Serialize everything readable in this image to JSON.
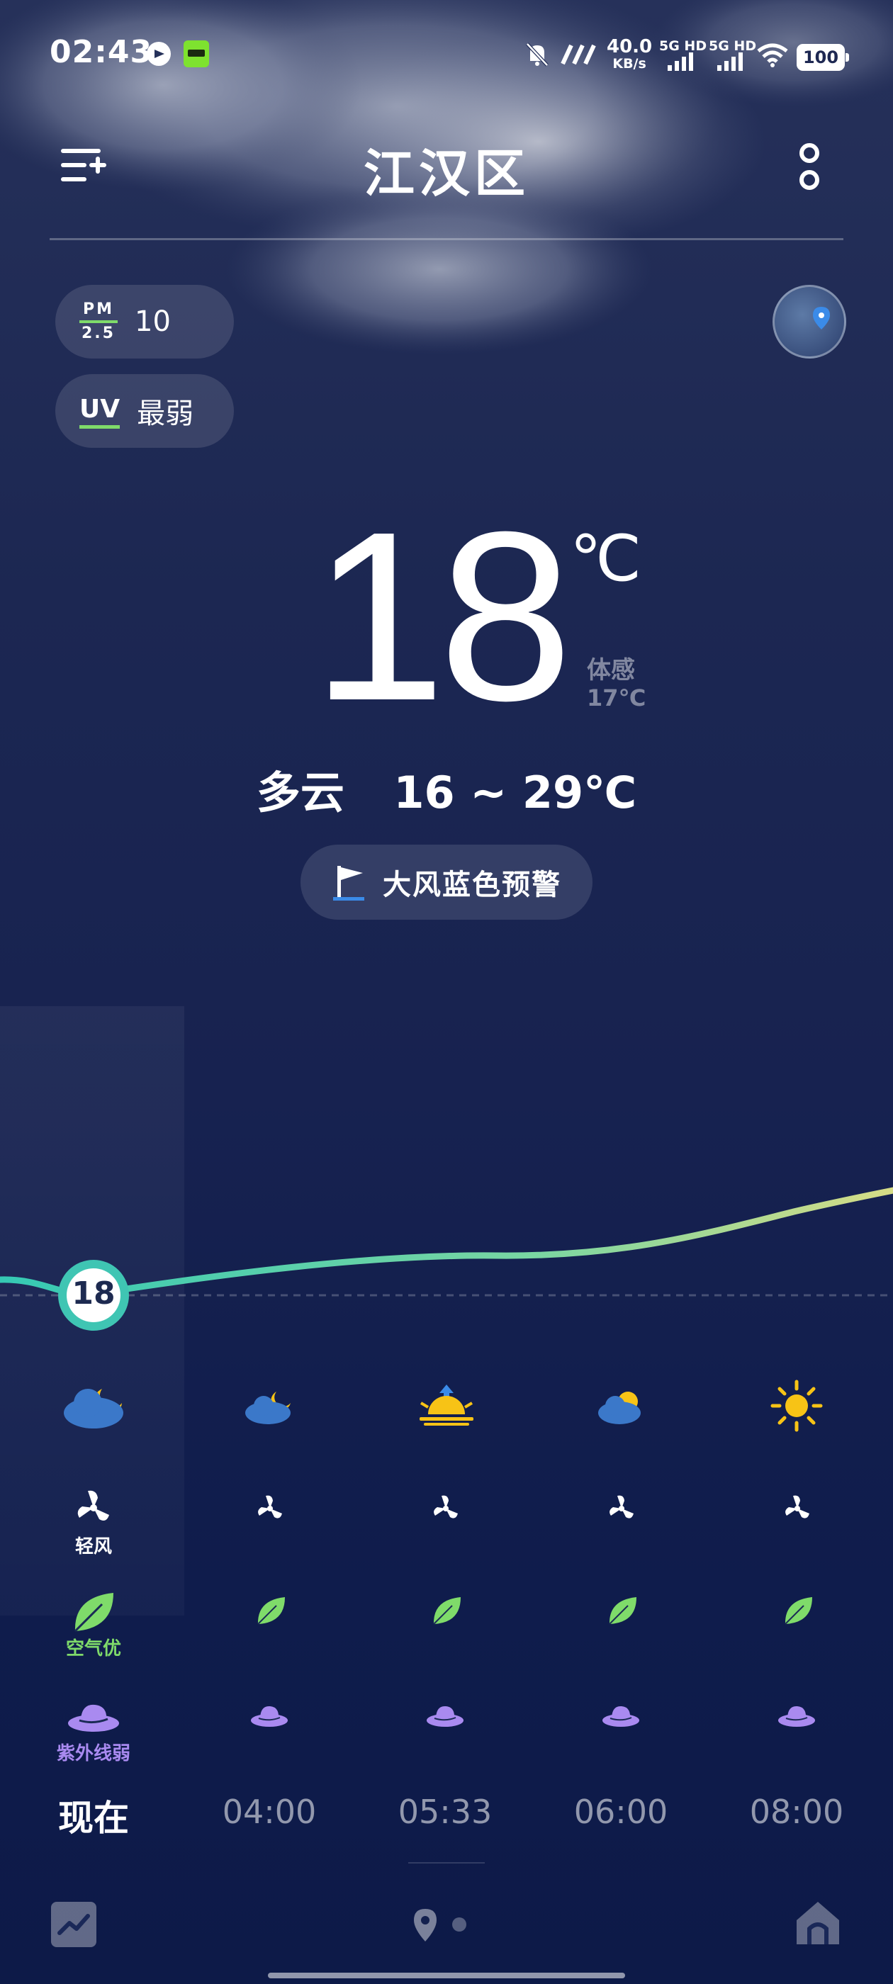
{
  "status_bar": {
    "time": "02:43",
    "net_speed_value": "40.0",
    "net_speed_unit": "KB/s",
    "signal_1": "5G HD",
    "signal_2": "5G HD",
    "battery": "100"
  },
  "header": {
    "city": "江汉区"
  },
  "air": {
    "pm_label_top": "PM",
    "pm_label_bottom": "2.5",
    "pm_value": "10",
    "uv_label": "UV",
    "uv_value": "最弱"
  },
  "current": {
    "temperature": "18",
    "unit": "℃",
    "feels_like_label": "体感",
    "feels_like_value": "17℃",
    "condition": "多云",
    "range": "16 ~ 29℃",
    "alert": "大风蓝色预警"
  },
  "hourly": {
    "now_temp": "18",
    "now_wind": "轻风",
    "now_air": "空气优",
    "now_uv": "紫外线弱",
    "items": [
      {
        "time": "现在",
        "icon": "cloudy-night-icon"
      },
      {
        "time": "04:00",
        "icon": "cloudy-night-icon"
      },
      {
        "time": "05:33",
        "icon": "sunrise-icon"
      },
      {
        "time": "06:00",
        "icon": "partly-cloudy-icon"
      },
      {
        "time": "08:00",
        "icon": "sun-icon"
      }
    ],
    "curve_colors": [
      "#35c9b4",
      "#7ad6a2",
      "#d6dc86"
    ]
  },
  "colors": {
    "accent_green": "#7fdb6a",
    "uv_purple": "#a98af0",
    "sun_yellow": "#f7c316",
    "cloud_blue": "#3b78c9",
    "background": "#172250"
  }
}
